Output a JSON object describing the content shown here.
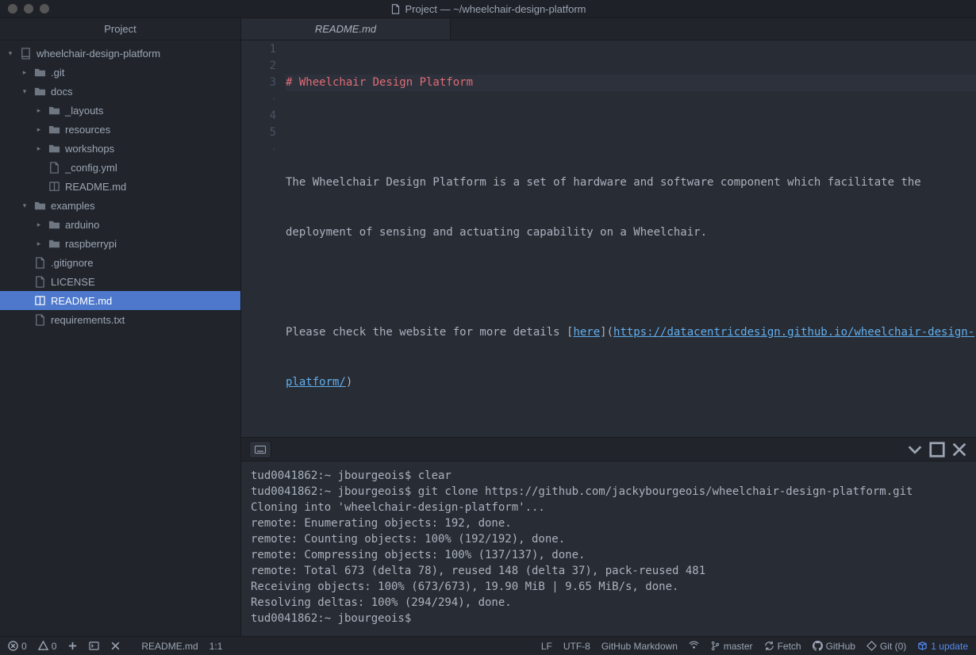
{
  "window": {
    "title": "Project — ~/wheelchair-design-platform"
  },
  "sidebar": {
    "title": "Project",
    "tree": [
      {
        "depth": 0,
        "icon": "repo",
        "chev": "down",
        "label": "wheelchair-design-platform"
      },
      {
        "depth": 1,
        "icon": "folder",
        "chev": "right",
        "label": ".git"
      },
      {
        "depth": 1,
        "icon": "folder",
        "chev": "down",
        "label": "docs"
      },
      {
        "depth": 2,
        "icon": "folder",
        "chev": "right",
        "label": "_layouts"
      },
      {
        "depth": 2,
        "icon": "folder",
        "chev": "right",
        "label": "resources"
      },
      {
        "depth": 2,
        "icon": "folder",
        "chev": "right",
        "label": "workshops"
      },
      {
        "depth": 2,
        "icon": "file",
        "chev": "",
        "label": "_config.yml"
      },
      {
        "depth": 2,
        "icon": "book",
        "chev": "",
        "label": "README.md"
      },
      {
        "depth": 1,
        "icon": "folder",
        "chev": "down",
        "label": "examples"
      },
      {
        "depth": 2,
        "icon": "folder",
        "chev": "right",
        "label": "arduino"
      },
      {
        "depth": 2,
        "icon": "folder",
        "chev": "right",
        "label": "raspberrypi"
      },
      {
        "depth": 1,
        "icon": "file",
        "chev": "",
        "label": ".gitignore"
      },
      {
        "depth": 1,
        "icon": "file",
        "chev": "",
        "label": "LICENSE"
      },
      {
        "depth": 1,
        "icon": "book",
        "chev": "",
        "label": "README.md",
        "selected": true
      },
      {
        "depth": 1,
        "icon": "file",
        "chev": "",
        "label": "requirements.txt"
      }
    ]
  },
  "tab": {
    "label": "README.md"
  },
  "editor": {
    "gutter": [
      "1",
      "2",
      "3",
      "·",
      "4",
      "5",
      "·"
    ],
    "content": {
      "l1": "# Wheelchair Design Platform",
      "l2": "",
      "l3a": "The Wheelchair Design Platform is a set of hardware and software component which facilitate the ",
      "l3b": "deployment of sensing and actuating capability on a Wheelchair.",
      "l4": "",
      "l5a": "Please check the website for more details [",
      "l5link1": "here",
      "l5b": "](",
      "l5link2a": "https://datacentricdesign.github.io/wheelchair-design-",
      "l5link2b": "platform/",
      "l5c": ")"
    }
  },
  "terminal": {
    "lines": [
      "tud0041862:~ jbourgeois$ clear",
      "tud0041862:~ jbourgeois$ git clone https://github.com/jackybourgeois/wheelchair-design-platform.git",
      "Cloning into 'wheelchair-design-platform'...",
      "remote: Enumerating objects: 192, done.",
      "remote: Counting objects: 100% (192/192), done.",
      "remote: Compressing objects: 100% (137/137), done.",
      "remote: Total 673 (delta 78), reused 148 (delta 37), pack-reused 481",
      "Receiving objects: 100% (673/673), 19.90 MiB | 9.65 MiB/s, done.",
      "Resolving deltas: 100% (294/294), done.",
      "tud0041862:~ jbourgeois$"
    ]
  },
  "status": {
    "errors": "0",
    "warnings": "0",
    "filename": "README.md",
    "pos": "1:1",
    "lineending": "LF",
    "encoding": "UTF-8",
    "grammar": "GitHub Markdown",
    "branch": "master",
    "fetch": "Fetch",
    "github": "GitHub",
    "git": "Git (0)",
    "update": "1 update"
  }
}
